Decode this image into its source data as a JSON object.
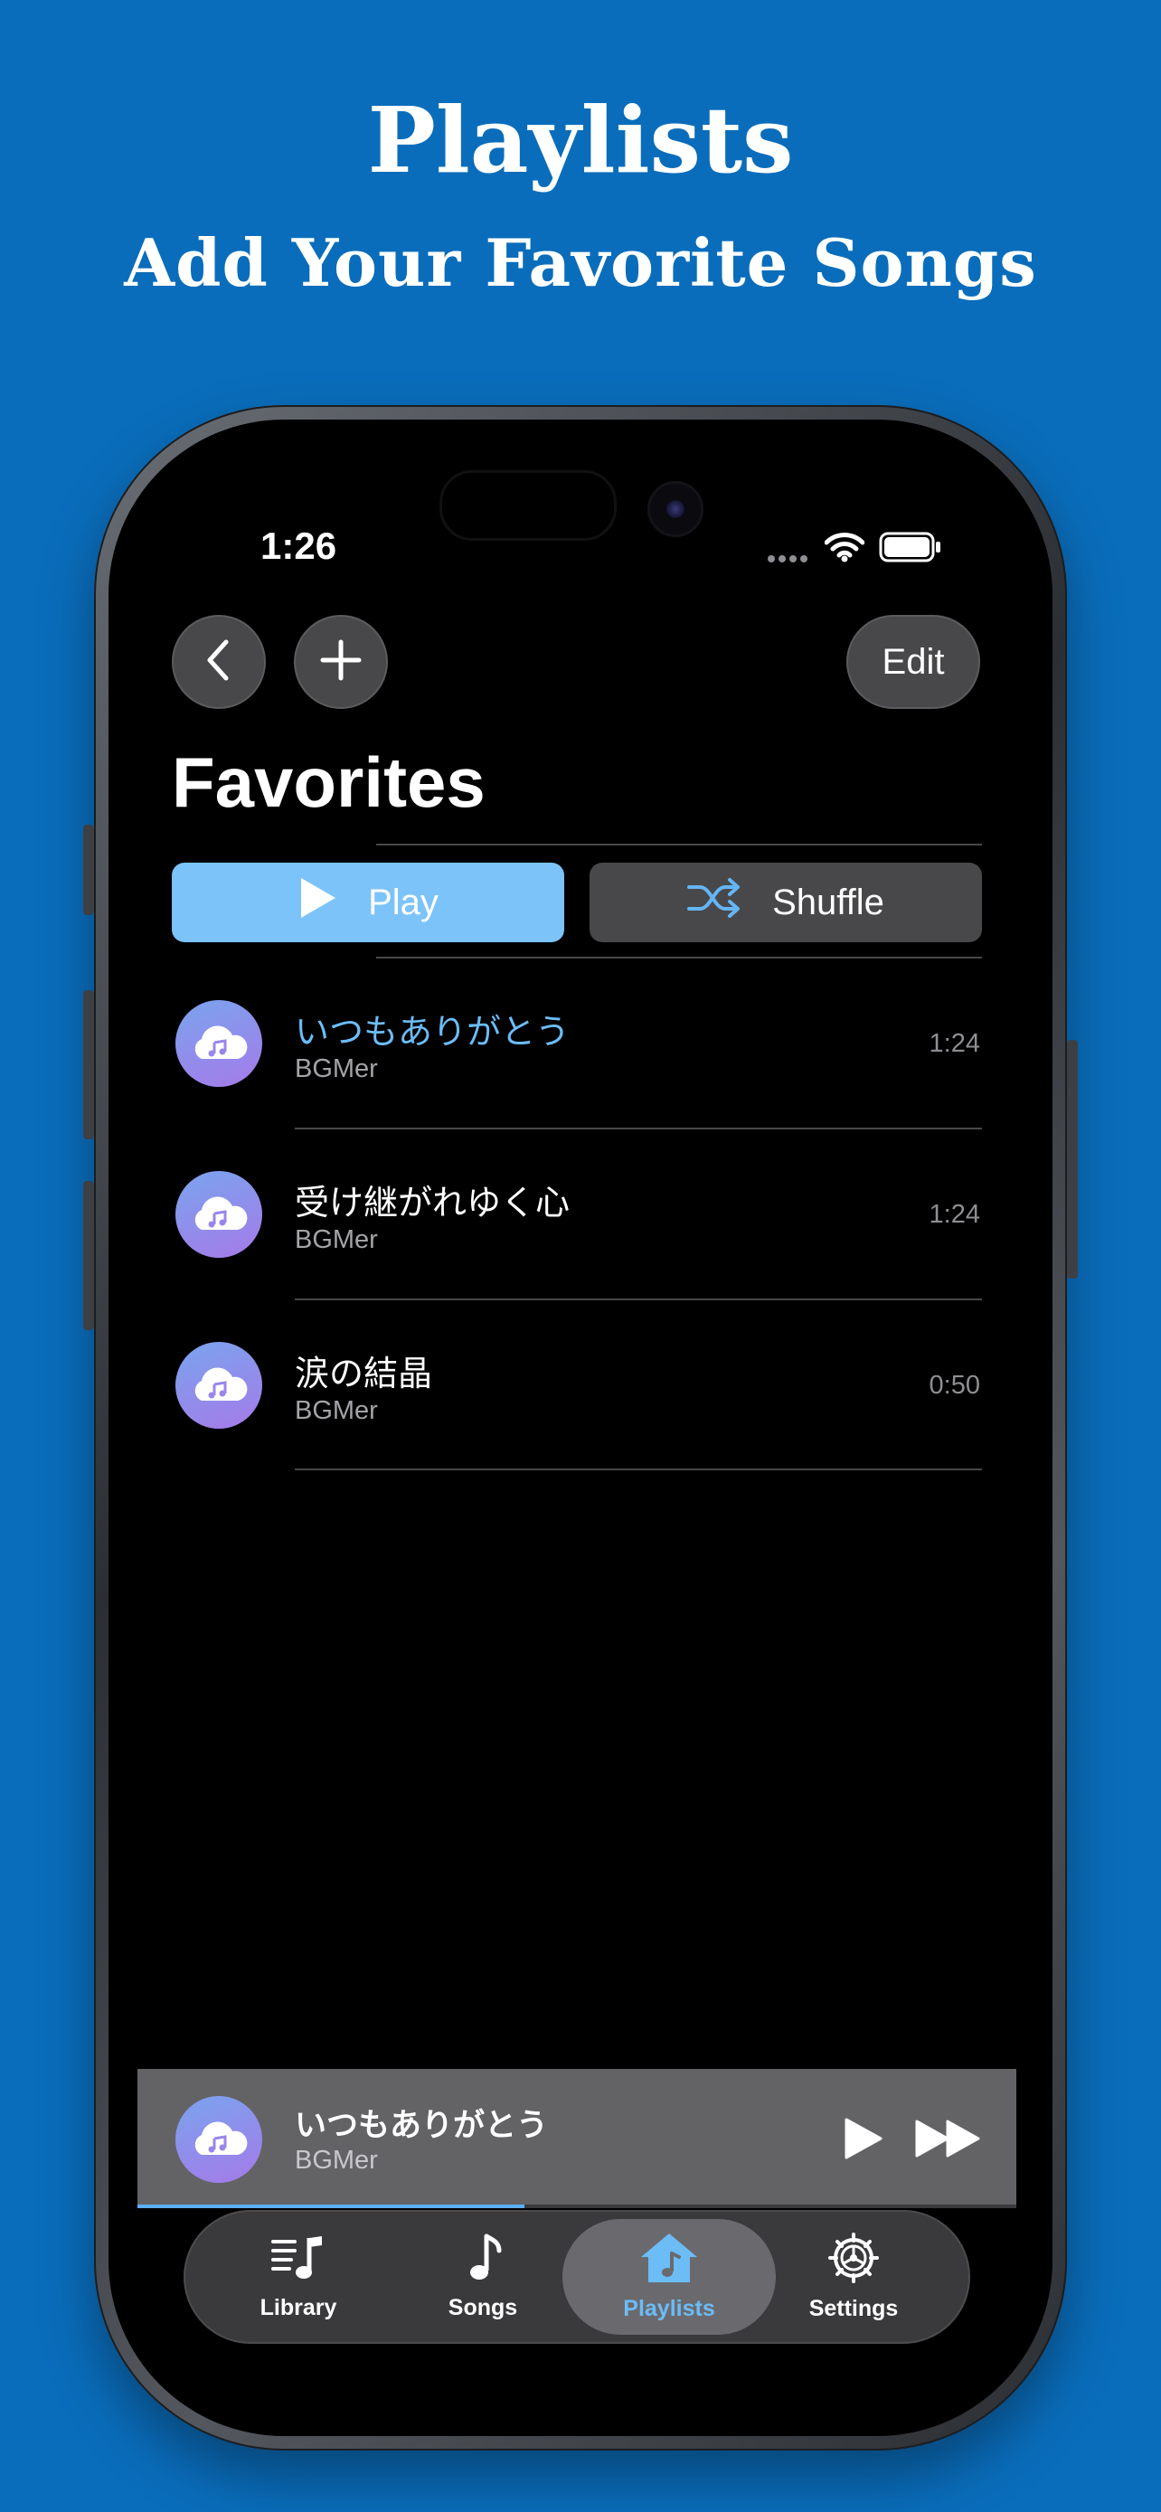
{
  "promo": {
    "title": "Playlists",
    "subtitle": "Add Your Favorite Songs"
  },
  "status_bar": {
    "time": "1:26",
    "icons": [
      "cellular-dots-icon",
      "wifi-icon",
      "battery-icon"
    ]
  },
  "nav": {
    "back_icon": "chevron-left-icon",
    "add_icon": "plus-icon",
    "edit_label": "Edit"
  },
  "playlist": {
    "title": "Favorites",
    "play_label": "Play",
    "shuffle_label": "Shuffle"
  },
  "songs": [
    {
      "title": "いつもありがとう",
      "artist": "BGMer",
      "duration": "1:24",
      "playing": true
    },
    {
      "title": "受け継がれゆく心",
      "artist": "BGMer",
      "duration": "1:24",
      "playing": false
    },
    {
      "title": "涙の結晶",
      "artist": "BGMer",
      "duration": "0:50",
      "playing": false
    }
  ],
  "now_playing": {
    "title": "いつもありがとう",
    "artist": "BGMer",
    "progress": 0.44
  },
  "tabs": [
    {
      "label": "Library",
      "icon": "library-music-icon",
      "active": false
    },
    {
      "label": "Songs",
      "icon": "music-note-icon",
      "active": false
    },
    {
      "label": "Playlists",
      "icon": "home-music-icon",
      "active": true
    },
    {
      "label": "Settings",
      "icon": "gear-icon",
      "active": false
    }
  ],
  "colors": {
    "background": "#0a6dbb",
    "accent": "#7cc3f9",
    "active_tab": "#6cbcf6",
    "playing_title": "#6cbcf6"
  }
}
